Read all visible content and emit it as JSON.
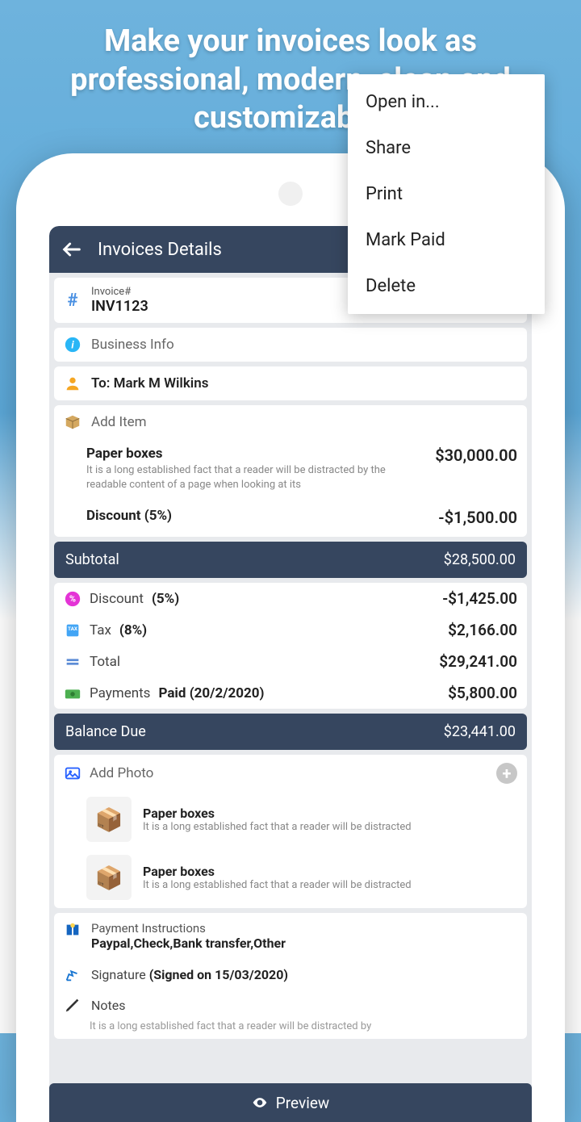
{
  "promo": "Make your invoices look as professional, modern, clean and customizable.",
  "appbar": {
    "title": "Invoices Details"
  },
  "menu": [
    "Open in...",
    "Share",
    "Print",
    "Mark Paid",
    "Delete"
  ],
  "invoice": {
    "label": "Invoice#",
    "number": "INV1123"
  },
  "business": {
    "label": "Business Info"
  },
  "to": {
    "prefix": "To: ",
    "name": "Mark M Wilkins"
  },
  "addItem": {
    "label": "Add Item"
  },
  "item": {
    "title": "Paper boxes",
    "desc": "It is a long established fact that a reader will be distracted by the readable content of a page when looking at its",
    "amount": "$30,000.00",
    "discountLabel": "Discount (5%)",
    "discountAmount": "-$1,500.00"
  },
  "subtotal": {
    "label": "Subtotal",
    "amount": "$28,500.00"
  },
  "totals": {
    "discount": {
      "name": "Discount",
      "pct": "(5%)",
      "amount": "-$1,425.00"
    },
    "tax": {
      "name": "Tax",
      "pct": "(8%)",
      "amount": "$2,166.00"
    },
    "total": {
      "name": "Total",
      "amount": "$29,241.00"
    },
    "payments": {
      "name": "Payments",
      "detail": "Paid (20/2/2020)",
      "amount": "$5,800.00"
    }
  },
  "balance": {
    "label": "Balance Due",
    "amount": "$23,441.00"
  },
  "addPhoto": {
    "label": "Add Photo"
  },
  "photos": [
    {
      "title": "Paper boxes",
      "desc": "It is a long established fact that a reader will be distracted"
    },
    {
      "title": "Paper boxes",
      "desc": "It is a long established fact that a reader will be distracted"
    }
  ],
  "payment": {
    "label": "Payment Instructions",
    "methods": "Paypal,Check,Bank transfer,Other"
  },
  "signature": {
    "label": "Signature",
    "detail": "(Signed on 15/03/2020)"
  },
  "notes": {
    "label": "Notes",
    "text": "It is a long established fact that a reader will be distracted by"
  },
  "preview": {
    "label": "Preview"
  }
}
